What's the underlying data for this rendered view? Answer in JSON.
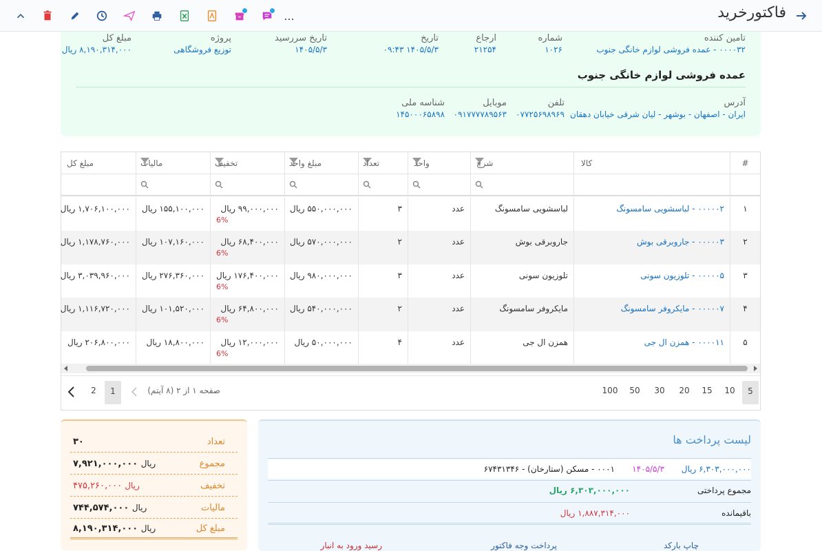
{
  "page_title": "فاکتورخرید",
  "toolbar": {
    "more": "..."
  },
  "header": {
    "supplier": {
      "label": "تامین کننده",
      "value": "۰۰۰۰۳۲ - عمده فروشی لوازم خانگی جنوب"
    },
    "number": {
      "label": "شماره",
      "value": "۱۰۲۶"
    },
    "reference": {
      "label": "ارجاع",
      "value": "۲۱۲۵۴"
    },
    "date": {
      "label": "تاریخ",
      "value": "۱۴۰۵/۵/۳ ۰۹:۴۳"
    },
    "due_date": {
      "label": "تاریخ سررسید",
      "value": "۱۴۰۵/۵/۳"
    },
    "project": {
      "label": "پروژه",
      "value": "توزیع فروشگاهی"
    },
    "total": {
      "label": "مبلغ کل",
      "value": "۸,۱۹۰,۳۱۴,۰۰۰ ریال"
    },
    "company_name": "عمده فروشی لوازم خانگی جنوب",
    "address": {
      "label": "آدرس",
      "value": "ایران - اصفهان - بوشهر - لیان شرقی خیابان دهقان"
    },
    "phone": {
      "label": "تلفن",
      "value": "۰۷۷۲۵۶۹۸۹۶۹"
    },
    "mobile": {
      "label": "موبایل",
      "value": "۰۹۱۷۷۷۷۸۹۵۶۳"
    },
    "national_id": {
      "label": "شناسه ملی",
      "value": "۱۴۵۰۰۰۶۵۸۹۸"
    }
  },
  "grid": {
    "columns": {
      "index": "#",
      "item": "کالا",
      "desc": "شرح",
      "unit": "واحد",
      "qty": "تعداد",
      "unit_price": "مبلغ واحد",
      "discount": "تخفیف",
      "tax": "مالیات",
      "total": "مبلغ کل"
    },
    "rows": [
      {
        "index": "۱",
        "item": "۰۰۰۰۰۲ - لباسشویی سامسونگ",
        "desc": "لباسشویی سامسونگ",
        "unit": "عدد",
        "qty": "۳",
        "unit_price": "۵۵۰,۰۰۰,۰۰۰ ریال",
        "discount": "۹۹,۰۰۰,۰۰۰ ریال",
        "discount_pct": "6%",
        "tax": "۱۵۵,۱۰۰,۰۰۰ ریال",
        "total": "۱,۷۰۶,۱۰۰,۰۰۰ ریال"
      },
      {
        "index": "۲",
        "item": "۰۰۰۰۰۳ - جاروبرقی بوش",
        "desc": "جاروبرقی بوش",
        "unit": "عدد",
        "qty": "۲",
        "unit_price": "۵۷۰,۰۰۰,۰۰۰ ریال",
        "discount": "۶۸,۴۰۰,۰۰۰ ریال",
        "discount_pct": "6%",
        "tax": "۱۰۷,۱۶۰,۰۰۰ ریال",
        "total": "۱,۱۷۸,۷۶۰,۰۰۰ ریال"
      },
      {
        "index": "۳",
        "item": "۰۰۰۰۰۵ - تلوزیون سونی",
        "desc": "تلوزیون سونی",
        "unit": "عدد",
        "qty": "۳",
        "unit_price": "۹۸۰,۰۰۰,۰۰۰ ریال",
        "discount": "۱۷۶,۴۰۰,۰۰۰ ریال",
        "discount_pct": "6%",
        "tax": "۲۷۶,۳۶۰,۰۰۰ ریال",
        "total": "۳,۰۳۹,۹۶۰,۰۰۰ ریال"
      },
      {
        "index": "۴",
        "item": "۰۰۰۰۰۷ - مایکروفر سامسونگ",
        "desc": "مایکروفر سامسونگ",
        "unit": "عدد",
        "qty": "۲",
        "unit_price": "۵۴۰,۰۰۰,۰۰۰ ریال",
        "discount": "۶۴,۸۰۰,۰۰۰ ریال",
        "discount_pct": "6%",
        "tax": "۱۰۱,۵۲۰,۰۰۰ ریال",
        "total": "۱,۱۱۶,۷۲۰,۰۰۰ ریال"
      },
      {
        "index": "۵",
        "item": "۰۰۰۰۱۱ - همزن ال جی",
        "desc": "همزن ال جی",
        "unit": "عدد",
        "qty": "۴",
        "unit_price": "۵۰,۰۰۰,۰۰۰ ریال",
        "discount": "۱۲,۰۰۰,۰۰۰ ریال",
        "discount_pct": "6%",
        "tax": "۱۸,۸۰۰,۰۰۰ ریال",
        "total": "۲۰۶,۸۰۰,۰۰۰ ریال"
      }
    ],
    "page_sizes": [
      "5",
      "10",
      "15",
      "20",
      "30",
      "50",
      "100"
    ],
    "selected_page_size": "5",
    "page_info": "صفحه ۱ از ۲ (۸ آیتم)",
    "pages": [
      "1",
      "2"
    ],
    "current_page": "1"
  },
  "summary": {
    "count": {
      "label": "تعداد",
      "value": "۳۰"
    },
    "subtotal": {
      "label": "مجموع",
      "value": "۷,۹۲۱,۰۰۰,۰۰۰",
      "currency": "ریال"
    },
    "discount": {
      "label": "تخفیف",
      "value": "۴۷۵,۲۶۰,۰۰۰",
      "currency": "ریال"
    },
    "tax": {
      "label": "مالیات",
      "value": "۷۴۴,۵۷۴,۰۰۰",
      "currency": "ریال"
    },
    "total": {
      "label": "مبلغ کل",
      "value": "۸,۱۹۰,۳۱۴,۰۰۰",
      "currency": "ریال"
    }
  },
  "payments": {
    "title": "لیست پرداخت ها",
    "row": {
      "amount": "۶,۳۰۳,۰۰۰,۰۰۰ ریال",
      "date": "۱۴۰۵/۵/۳",
      "desc": "۰۰۰۱ - مسکن (ستارخان) - ۶۷۴۳۱۳۴۶"
    },
    "total_paid": {
      "label": "مجموع پرداختی",
      "value": "۶,۳۰۳,۰۰۰,۰۰۰ ریال"
    },
    "remaining": {
      "label": "باقیمانده",
      "value": "۱,۸۸۷,۳۱۴,۰۰۰ ریال"
    },
    "actions": {
      "barcode": "چاپ بارکد",
      "pay": "پرداخت وجه فاکتور",
      "receipt": "رسید ورود به انبار"
    }
  },
  "colors": {
    "accent": "#1a73c0",
    "header_bg": "#ecfdf3",
    "summary_bg": "#fff7ed",
    "payments_bg": "#eff6fc",
    "danger": "#d0343f"
  }
}
